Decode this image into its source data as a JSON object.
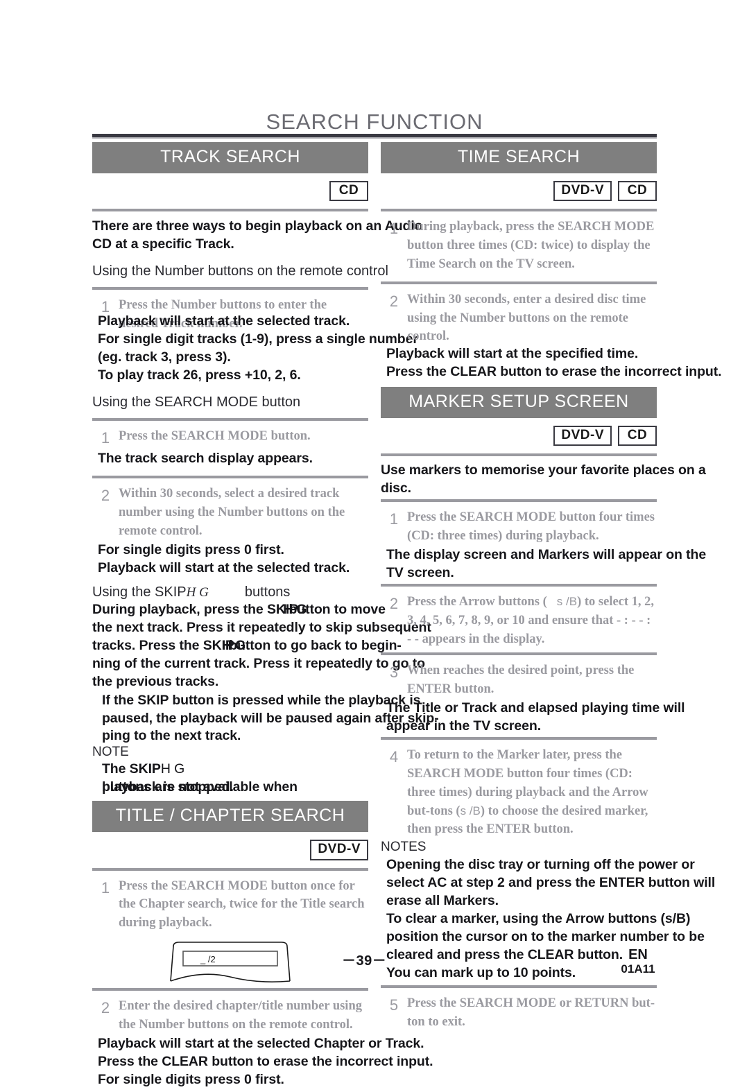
{
  "page": {
    "title": "SEARCH FUNCTION",
    "number": "－39－",
    "lang_code": "EN",
    "doc_code": "01A11"
  },
  "sections": {
    "track_search": {
      "heading": "TRACK SEARCH",
      "badges": [
        "CD"
      ],
      "intro": [
        "There are three ways to begin playback on an Audio",
        "CD at a specific Track."
      ],
      "sub1": "Using the Number buttons on the remote control",
      "step1_num": "1",
      "step1_text": "Press the Number buttons to enter the desired Track number.",
      "result1": [
        "Playback will start at the selected track.",
        "For single digit tracks (1-9), press a single number",
        "(eg. track 3, press 3).",
        "To play track 26, press +10, 2, 6."
      ],
      "sub2": "Using the SEARCH MODE button",
      "step2_num": "1",
      "step2_text": "Press the SEARCH MODE button.",
      "result2": [
        "The track search display appears."
      ],
      "step3_num": "2",
      "step3_text": "Within 30 seconds, select a desired track number using the Number buttons on the remote control.",
      "result3": [
        "For single digits press 0 first.",
        "Playback will start at the selected track."
      ],
      "sub3_pre": "Using the SKIP",
      "sub3_sym": "H G",
      "sub3_post": "buttons",
      "skip_para": [
        "During playback, press the SKIP",
        "button to move",
        "the next track. Press it repeatedly to skip subsequent",
        "tracks. Press the SKIP",
        "button to go back to begin-",
        "ning of the current track. Press it repeatedly to go to",
        "the previous tracks."
      ],
      "skip_para2": [
        "If the SKIP button is pressed while the playback is",
        "paused, the playback will be paused again after skip-",
        "ping to the next track."
      ],
      "note_label": "NOTE",
      "note_pre": "The SKIP",
      "note_sym": "H G",
      "note_post": "buttons are not available when",
      "note_line2": "playback is stopped."
    },
    "title_chapter_search": {
      "heading": "TITLE / CHAPTER SEARCH",
      "badges": [
        "DVD-V"
      ],
      "step1_num": "1",
      "step1_text": "Press the SEARCH MODE button once for the Chapter search, twice for the Title search during playback.",
      "screen_display": "_ /2",
      "step2_num": "2",
      "step2_text": "Enter the desired chapter/title number using the Number buttons on the remote control.",
      "result": [
        "Playback will start at the selected Chapter or Track.",
        "Press the CLEAR button to erase the incorrect input.",
        "For single digits press 0 first."
      ]
    },
    "time_search": {
      "heading": "TIME SEARCH",
      "badges": [
        "DVD-V",
        "CD"
      ],
      "step1_num": "1",
      "step1_text": "During playback, press the SEARCH MODE button three times (CD: twice) to display the Time Search on the TV screen.",
      "step2_num": "2",
      "step2_text": "Within 30 seconds, enter a desired disc time using the Number buttons on the remote control.",
      "result": [
        "Playback will start at the specified time.",
        "Press the CLEAR button to erase the incorrect input."
      ]
    },
    "marker_setup": {
      "heading": "MARKER SETUP SCREEN",
      "badges": [
        "DVD-V",
        "CD"
      ],
      "intro": [
        "Use markers to memorise your favorite places on a",
        "disc."
      ],
      "step1_num": "1",
      "step1_text": "Press the SEARCH MODE button four times (CD: three times) during playback.",
      "result1": [
        "The display screen and Markers will appear on the",
        "TV screen."
      ],
      "step2_num": "2",
      "step2_text_pre": "Press the Arrow buttons (",
      "step2_sym": "s /B",
      "step2_text_post": ") to select 1, 2, 3, 4, 5, 6, 7, 8, 9, or 10 and ensure that - : - - : - - appears in the display.",
      "step3_num": "3",
      "step3_text": "When reaches the desired point, press the ENTER button.",
      "result3": [
        "The Title or Track and elapsed playing time will",
        "appear in the TV screen."
      ],
      "step4_num": "4",
      "step4_text_pre": "To return to the Marker later, press the SEARCH MODE button four times (CD: three times) during playback and the Arrow but-tons (",
      "step4_sym": "s /B",
      "step4_text_post": ") to choose the desired marker, then press the ENTER button.",
      "notes_label": "NOTES",
      "notes": [
        "Opening the disc tray or turning off the power or",
        "select AC at step 2 and press the ENTER button will",
        "erase all Markers.",
        "To clear a marker, using the Arrow buttons (s/B)",
        "position the cursor on to the marker number to be",
        "cleared and press the CLEAR button.",
        "You can mark up to 10 points."
      ],
      "step5_num": "5",
      "step5_text": "Press the SEARCH MODE or RETURN but-ton to exit."
    }
  }
}
